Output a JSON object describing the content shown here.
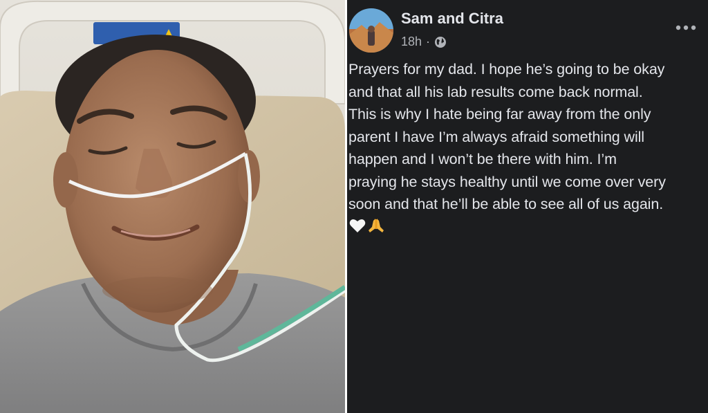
{
  "photo": {
    "description_icon": "hospital-selfie-photo"
  },
  "post": {
    "author": "Sam and Citra",
    "time": "18h",
    "separator": "·",
    "audience_icon": "globe-icon",
    "more_icon": "more-options-icon",
    "lines": [
      "Prayers for my dad. I hope he’s going to be okay",
      "and that all his lab results come back normal.",
      "This is why I hate being far away from the only",
      "parent I have I’m always afraid something will",
      "happen and I won’t be there with him. I’m",
      "praying he stays healthy until we come over very",
      "soon and that he’ll be able to see all of us again."
    ],
    "emojis": [
      "white-heart-icon",
      "folded-hands-icon"
    ]
  },
  "colors": {
    "post_background": "#1c1d1f",
    "text_primary": "#e4e6eb",
    "text_secondary": "#b0b3b8"
  }
}
